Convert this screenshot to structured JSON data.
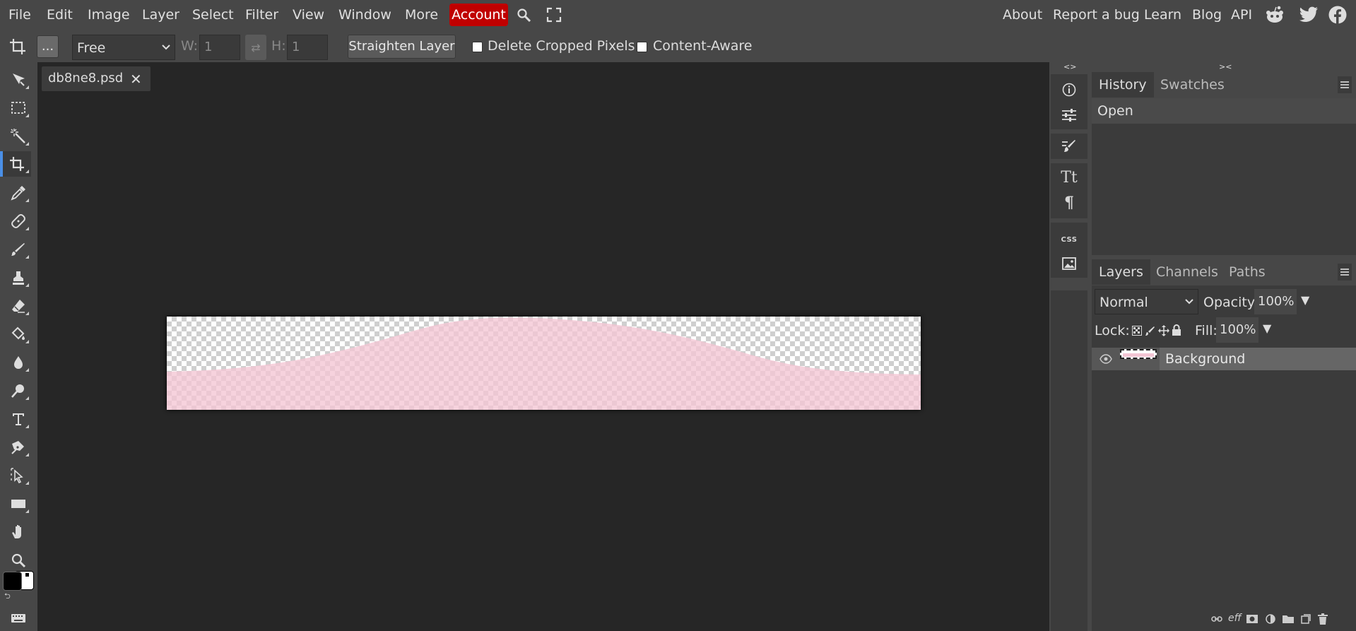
{
  "menubar": {
    "items": [
      "File",
      "Edit",
      "Image",
      "Layer",
      "Select",
      "Filter",
      "View",
      "Window",
      "More"
    ],
    "account": "Account",
    "right_links": [
      "About",
      "Report a bug",
      "Learn",
      "Blog",
      "API"
    ],
    "social_icons": [
      "reddit-icon",
      "twitter-icon",
      "facebook-icon"
    ],
    "accent_color": "#c00000"
  },
  "options": {
    "more_label": "...",
    "ratio_select": "Free",
    "w_label": "W:",
    "w_value": "1",
    "swap_icon": "swap-icon",
    "h_label": "H:",
    "h_value": "1",
    "straighten": "Straighten Layer",
    "delete_cropped": "Delete Cropped Pixels",
    "content_aware": "Content-Aware"
  },
  "tools": [
    "move-tool",
    "marquee-tool",
    "magic-wand-tool",
    "crop-tool",
    "eyedropper-tool",
    "healing-tool",
    "brush-tool",
    "clone-stamp-tool",
    "eraser-tool",
    "fill-tool",
    "blur-tool",
    "dodge-tool",
    "type-tool",
    "pen-tool",
    "path-select-tool",
    "shape-tool",
    "hand-tool",
    "zoom-tool"
  ],
  "colors": {
    "foreground": "#000000",
    "background": "#ffffff"
  },
  "document": {
    "tab_name": "db8ne8.psd",
    "fill_color": "#f3c5d4"
  },
  "collapse": {
    "left": "<>",
    "right": "><"
  },
  "history": {
    "tabs": [
      "History",
      "Swatches"
    ],
    "items": [
      "Open"
    ]
  },
  "layers": {
    "tabs": [
      "Layers",
      "Channels",
      "Paths"
    ],
    "blend_mode": "Normal",
    "opacity_label": "Opacity:",
    "opacity_value": "100%",
    "lock_label": "Lock:",
    "fill_label": "Fill:",
    "fill_value": "100%",
    "items": [
      {
        "name": "Background",
        "visible": true
      }
    ],
    "footer_icons": [
      "link-icon",
      "effects-icon",
      "mask-icon",
      "adjustment-icon",
      "folder-icon",
      "new-layer-icon",
      "trash-icon"
    ],
    "effects_label": "eff"
  },
  "strip": {
    "css_label": "CSS"
  }
}
